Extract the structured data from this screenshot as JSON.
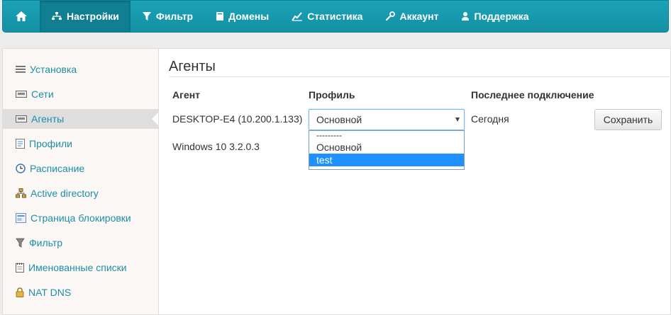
{
  "nav": {
    "home_icon": "home-icon",
    "items": [
      {
        "label": "Настройки",
        "icon": "network-icon",
        "active": true
      },
      {
        "label": "Фильтр",
        "icon": "filter-icon"
      },
      {
        "label": "Домены",
        "icon": "book-icon"
      },
      {
        "label": "Статистика",
        "icon": "chart-icon"
      },
      {
        "label": "Аккаунт",
        "icon": "wrench-icon"
      },
      {
        "label": "Поддержка",
        "icon": "person-icon"
      }
    ]
  },
  "sidebar": {
    "items": [
      {
        "label": "Установка",
        "icon": "list-icon"
      },
      {
        "label": "Сети",
        "icon": "network-card-icon"
      },
      {
        "label": "Агенты",
        "icon": "agent-card-icon",
        "active": true
      },
      {
        "label": "Профили",
        "icon": "profile-doc-icon"
      },
      {
        "label": "Расписание",
        "icon": "clock-icon"
      },
      {
        "label": "Active directory",
        "icon": "directory-tree-icon"
      },
      {
        "label": "Страница блокировки",
        "icon": "block-page-icon"
      },
      {
        "label": "Фильтр",
        "icon": "filter-icon"
      },
      {
        "label": "Именованные списки",
        "icon": "notepad-icon"
      },
      {
        "label": "NAT DNS",
        "icon": "lock-icon"
      }
    ]
  },
  "main": {
    "title": "Агенты",
    "columns": {
      "agent": "Агент",
      "profile": "Профиль",
      "last": "Последнее подключение"
    },
    "row": {
      "agent_name": "DESKTOP-E4 (10.200.1.133)",
      "agent_os": "Windows 10 3.2.0.3",
      "profile_value": "Основной",
      "profile_options": [
        "---------",
        "Основной",
        "test"
      ],
      "highlighted_option": "test",
      "last_connection": "Сегодня",
      "save_label": "Сохранить"
    }
  },
  "colors": {
    "nav_bg": "#1aa3b8",
    "nav_active": "#0f7f91",
    "link": "#1d8fa7",
    "option_highlight": "#1e90ff"
  }
}
